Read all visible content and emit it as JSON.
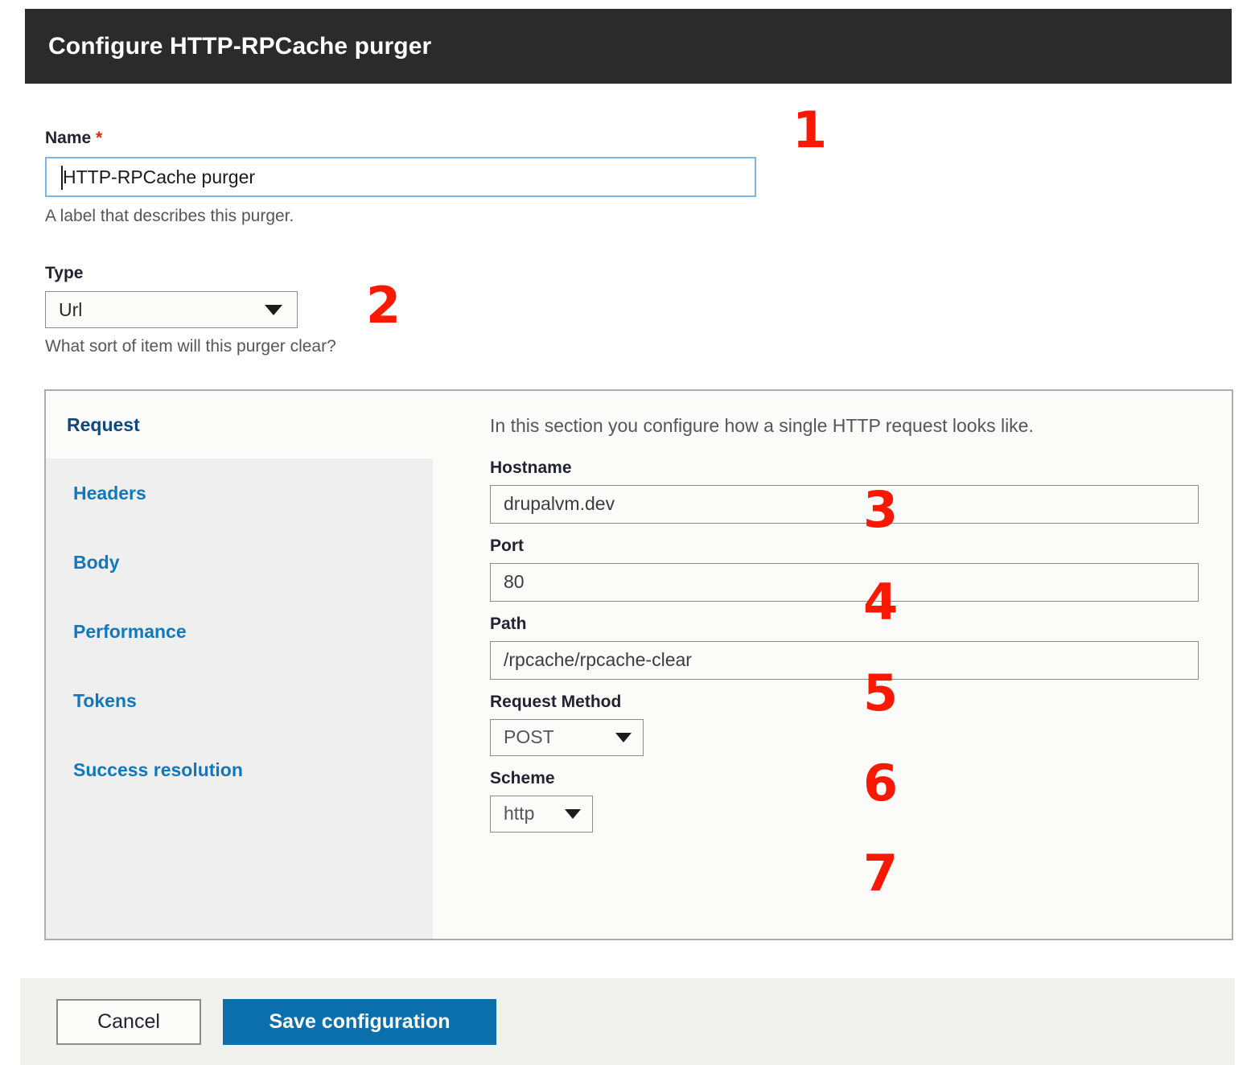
{
  "header": {
    "title": "Configure HTTP-RPCache purger"
  },
  "form": {
    "name": {
      "label": "Name",
      "required_marker": "*",
      "value": "HTTP-RPCache purger",
      "description": "A label that describes this purger."
    },
    "type": {
      "label": "Type",
      "value": "Url",
      "description": "What sort of item will this purger clear?",
      "options": [
        "Url"
      ]
    }
  },
  "tabs": {
    "active_index": 0,
    "items": [
      {
        "label": "Request"
      },
      {
        "label": "Headers"
      },
      {
        "label": "Body"
      },
      {
        "label": "Performance"
      },
      {
        "label": "Tokens"
      },
      {
        "label": "Success resolution"
      }
    ]
  },
  "request_tab": {
    "intro": "In this section you configure how a single HTTP request looks like.",
    "hostname": {
      "label": "Hostname",
      "value": "drupalvm.dev"
    },
    "port": {
      "label": "Port",
      "value": "80"
    },
    "path": {
      "label": "Path",
      "value": "/rpcache/rpcache-clear"
    },
    "request_method": {
      "label": "Request Method",
      "value": "POST",
      "options": [
        "POST"
      ]
    },
    "scheme": {
      "label": "Scheme",
      "value": "http",
      "options": [
        "http"
      ]
    }
  },
  "actions": {
    "cancel_label": "Cancel",
    "save_label": "Save configuration"
  },
  "annotations": {
    "n1": "1",
    "n2": "2",
    "n3": "3",
    "n4": "4",
    "n5": "5",
    "n6": "6",
    "n7": "7"
  },
  "colors": {
    "header_bg": "#2b2b2b",
    "link_blue": "#1278bd",
    "active_tab_blue": "#12477e",
    "primary_button": "#0b6ead",
    "annotation_red": "#fb1800",
    "required_red": "#e32700",
    "focus_ring": "#7fb5e6"
  }
}
